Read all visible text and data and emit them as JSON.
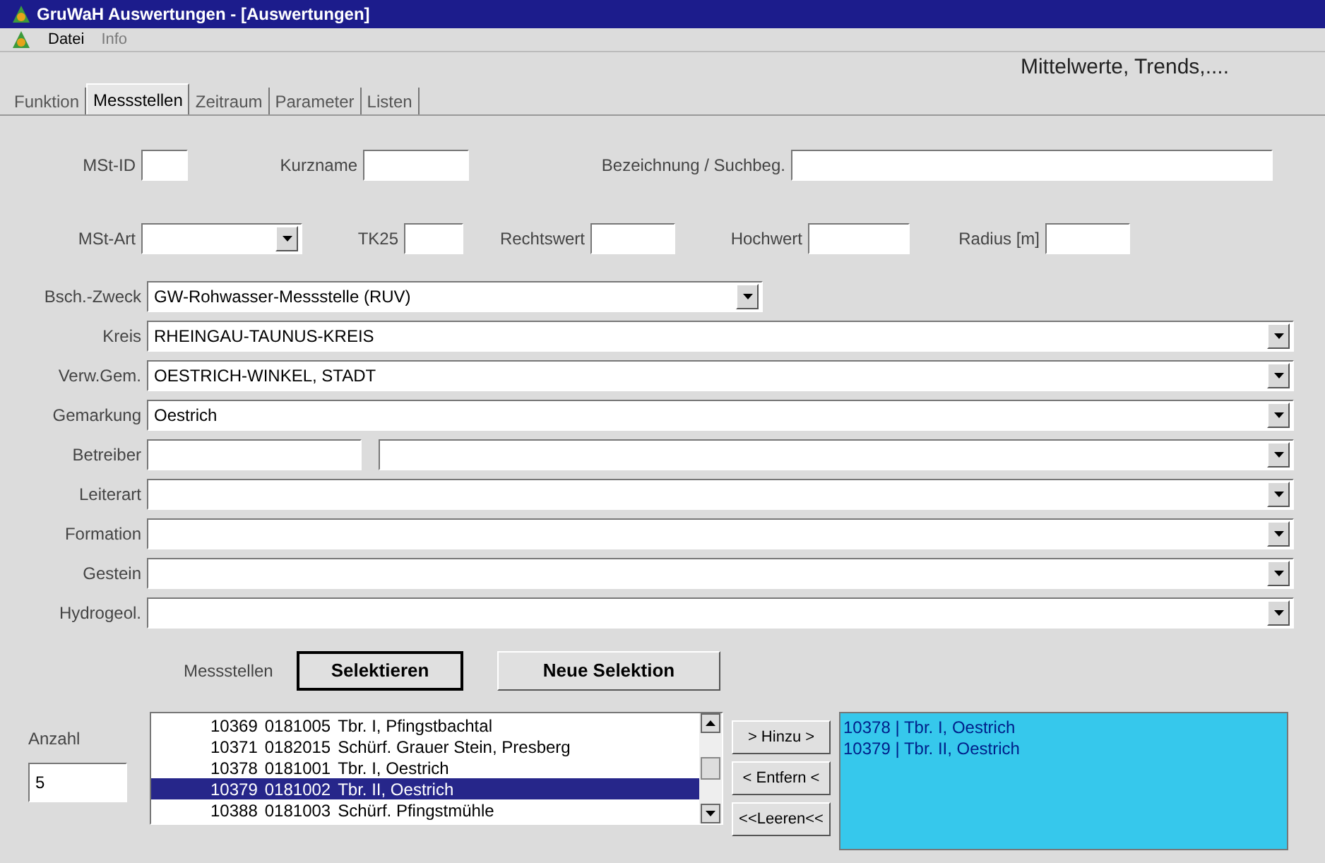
{
  "window": {
    "title": "GruWaH Auswertungen - [Auswertungen]"
  },
  "menu": [
    {
      "label": "Datei",
      "disabled": false
    },
    {
      "label": "Info",
      "disabled": true
    }
  ],
  "header": "Mittelwerte, Trends,....",
  "tabs": [
    {
      "label": "Funktion",
      "selected": false
    },
    {
      "label": "Messstellen",
      "selected": true
    },
    {
      "label": "Zeitraum",
      "selected": false
    },
    {
      "label": "Parameter",
      "selected": false
    },
    {
      "label": "Listen",
      "selected": false
    }
  ],
  "filter_row_1": [
    {
      "label": "MSt-ID",
      "kind": "text"
    },
    {
      "label": "Kurzname",
      "kind": "text"
    },
    {
      "label": "Bezeichnung / Suchbeg.",
      "kind": "text"
    }
  ],
  "filter_row_2": [
    {
      "label": "MSt-Art",
      "kind": "dropdown"
    },
    {
      "label": "TK25",
      "kind": "text"
    },
    {
      "label": "Rechtswert",
      "kind": "text"
    },
    {
      "label": "Hochwert",
      "kind": "text"
    },
    {
      "label": "Radius [m]",
      "kind": "text"
    }
  ],
  "combo_rows": [
    {
      "label": "Bsch.-Zweck",
      "value": "GW-Rohwasser-Messstelle (RUV)",
      "kind": "short"
    },
    {
      "label": "Kreis",
      "value": "RHEINGAU-TAUNUS-KREIS",
      "kind": "full"
    },
    {
      "label": "Verw.Gem.",
      "value": "OESTRICH-WINKEL, STADT",
      "kind": "full"
    },
    {
      "label": "Gemarkung",
      "value": "Oestrich",
      "kind": "full"
    },
    {
      "label": "Betreiber",
      "kind": "split"
    },
    {
      "label": "Leiterart",
      "kind": "full"
    },
    {
      "label": "Formation",
      "kind": "full"
    },
    {
      "label": "Gestein",
      "kind": "full"
    },
    {
      "label": "Hydrogeol.",
      "kind": "full"
    }
  ],
  "selection": {
    "label": "Messstellen",
    "buttons": [
      {
        "label": "Selektieren",
        "default": true
      },
      {
        "label": "Neue Selektion",
        "default": false
      }
    ]
  },
  "count": {
    "label": "Anzahl",
    "value": "5"
  },
  "station_list": [
    {
      "id": "10369",
      "code": "0181005",
      "name": "Tbr. I, Pfingstbachtal",
      "selected": false
    },
    {
      "id": "10371",
      "code": "0182015",
      "name": "Schürf. Grauer Stein, Presberg",
      "selected": false
    },
    {
      "id": "10378",
      "code": "0181001",
      "name": "Tbr. I, Oestrich",
      "selected": false
    },
    {
      "id": "10379",
      "code": "0181002",
      "name": "Tbr. II, Oestrich",
      "selected": true
    },
    {
      "id": "10388",
      "code": "0181003",
      "name": "Schürf. Pfingstmühle",
      "selected": false
    }
  ],
  "transfer_buttons": [
    "> Hinzu >",
    "< Entfern <",
    "<<Leeren<<"
  ],
  "chosen_list": [
    "10378 | Tbr. I, Oestrich",
    "10379 | Tbr. II, Oestrich"
  ]
}
